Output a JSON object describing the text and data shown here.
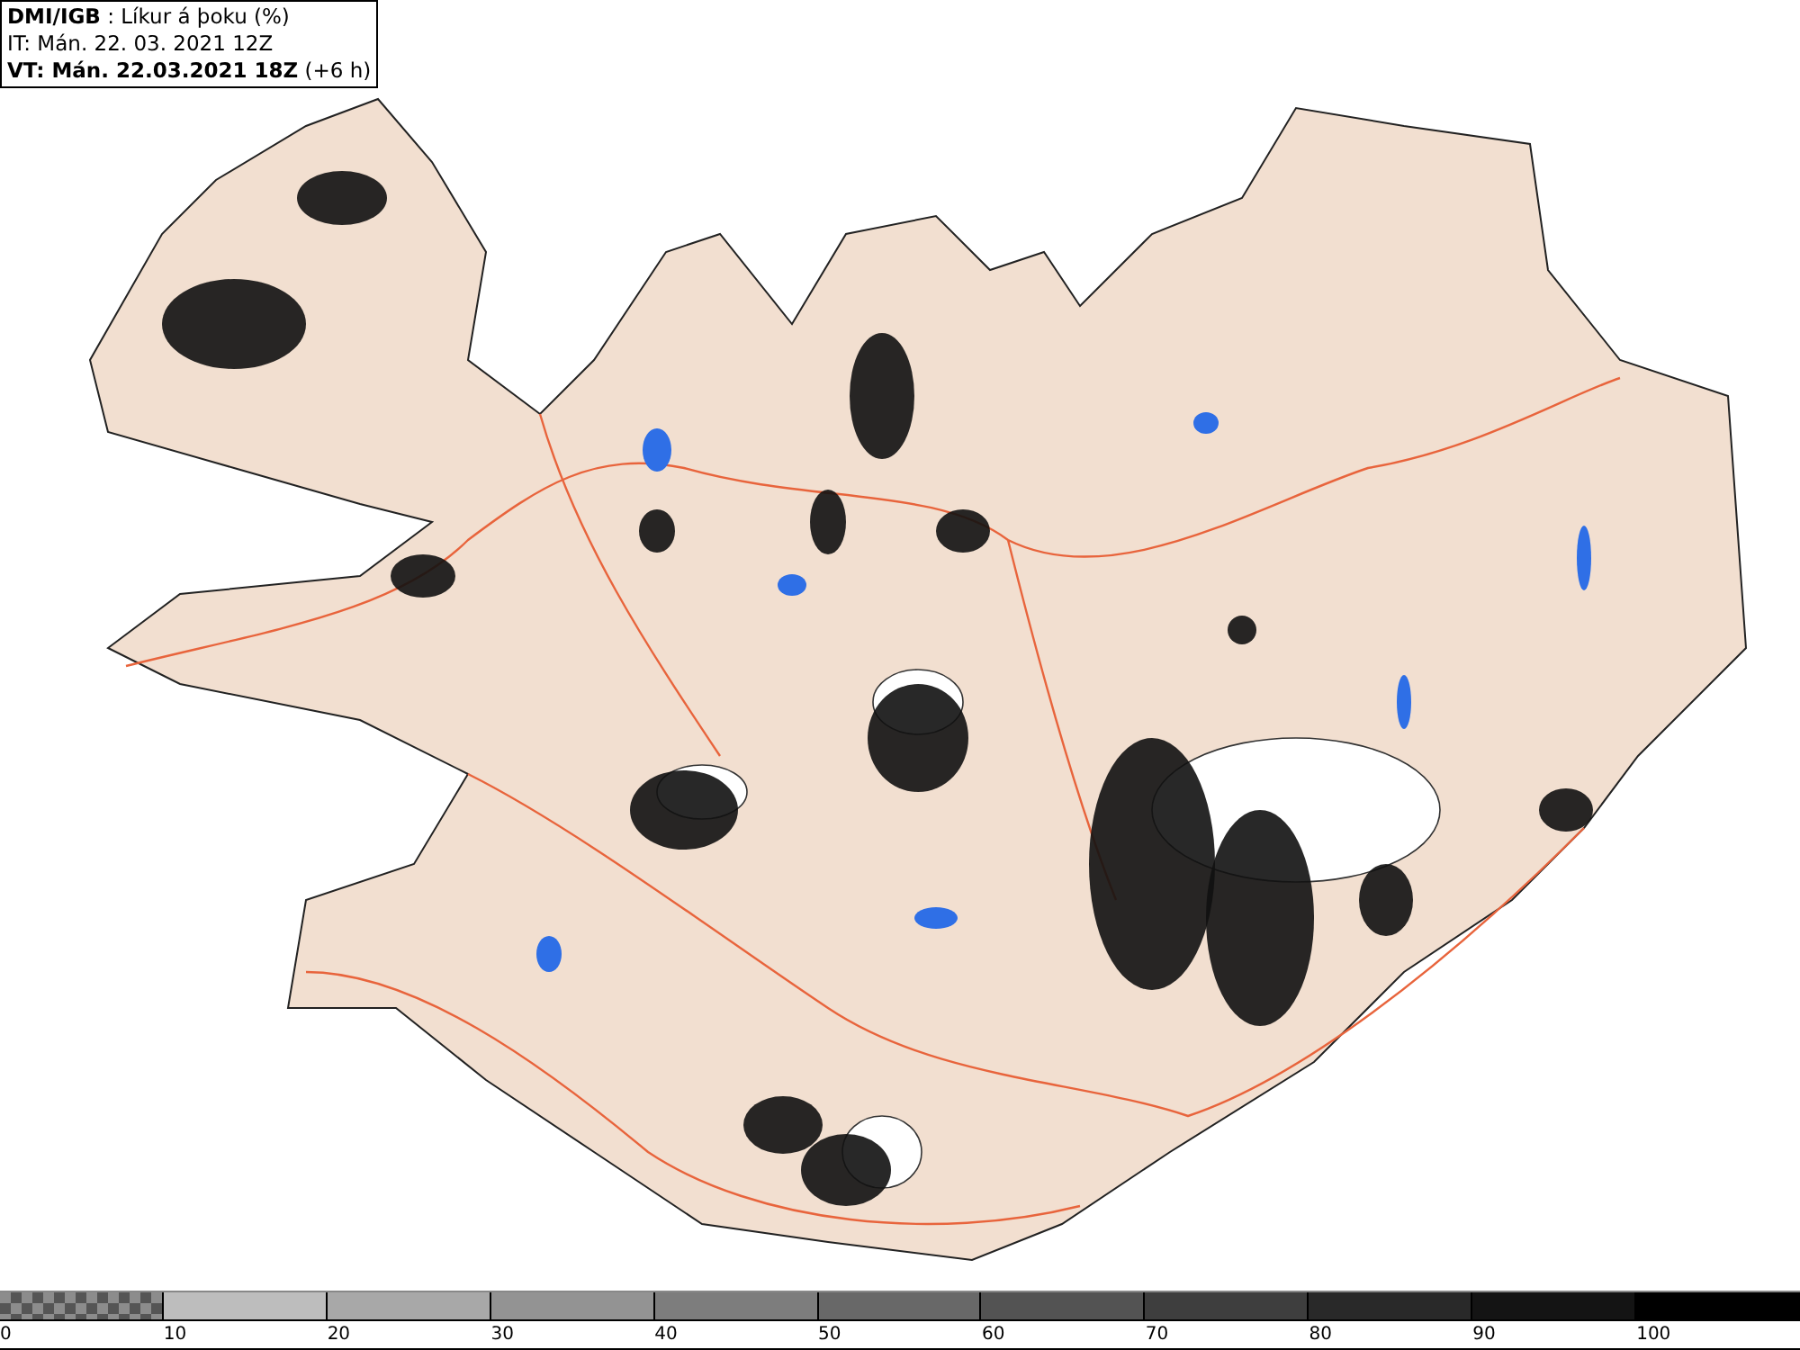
{
  "title_box": {
    "lines": [
      "**DMI/IGB** : Líkur á þoku (%)",
      "IT: Mán. 22. 03. 2021 12Z",
      "**VT: Mán. 22.03.2021 18Z** (+6 h)"
    ]
  },
  "legend": {
    "segments": [
      {
        "kind": "checker",
        "color": "#8c8c8c"
      },
      {
        "kind": "solid",
        "color": "#bdbdbd"
      },
      {
        "kind": "solid",
        "color": "#a8a8a8"
      },
      {
        "kind": "solid",
        "color": "#939393"
      },
      {
        "kind": "solid",
        "color": "#7d7d7d"
      },
      {
        "kind": "solid",
        "color": "#686868"
      },
      {
        "kind": "solid",
        "color": "#535353"
      },
      {
        "kind": "solid",
        "color": "#3e3e3e"
      },
      {
        "kind": "solid",
        "color": "#292929"
      },
      {
        "kind": "solid",
        "color": "#141414"
      },
      {
        "kind": "solid",
        "color": "#000000"
      }
    ],
    "labels": [
      "0",
      "10",
      "20",
      "30",
      "40",
      "50",
      "60",
      "70",
      "80",
      "90",
      "100"
    ]
  }
}
